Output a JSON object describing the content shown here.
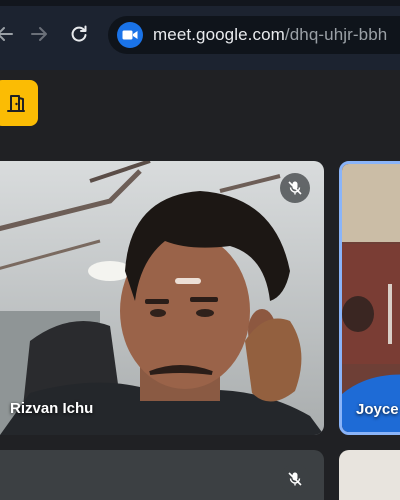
{
  "browser": {
    "url_host": "meet.google.com",
    "url_path": "/dhq-uhjr-bbh",
    "site_icon": "video-camera-icon"
  },
  "meet": {
    "accent_color": "#fbbc04",
    "active_speaker_border": "#8ab4f8",
    "participants": [
      {
        "name": "Rizvan Ichu",
        "muted": true
      },
      {
        "name": "Joyce",
        "muted": false
      },
      {
        "name": "",
        "muted": true
      },
      {
        "name": "",
        "muted": false
      }
    ]
  }
}
